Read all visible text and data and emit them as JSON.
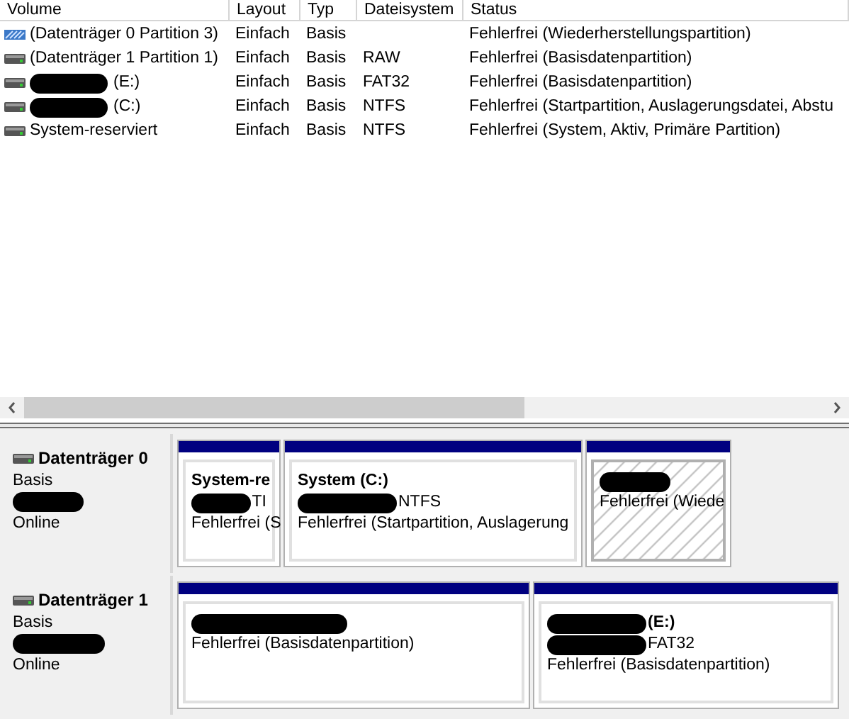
{
  "columns": [
    "Volume",
    "Layout",
    "Typ",
    "Dateisystem",
    "Status"
  ],
  "volumes": [
    {
      "kind": "recovery",
      "redacted": false,
      "volume": "(Datenträger 0 Partition 3)",
      "layout": "Einfach",
      "typ": "Basis",
      "status": "Fehlerfrei (Wiederherstellungspartition)"
    },
    {
      "kind": "basic",
      "redacted": false,
      "volume": "(Datenträger 1 Partition 1)",
      "layout": "Einfach",
      "typ": "Basis",
      "dateisystem": "RAW",
      "status": "Fehlerfrei (Basisdatenpartition)"
    },
    {
      "kind": "basic",
      "redacted": true,
      "volume": "(E:)",
      "layout": "Einfach",
      "typ": "Basis",
      "dateisystem": "FAT32",
      "status": "Fehlerfrei (Basisdatenpartition)"
    },
    {
      "kind": "basic",
      "redacted": true,
      "volume": "(C:)",
      "layout": "Einfach",
      "typ": "Basis",
      "dateisystem": "NTFS",
      "status": "Fehlerfrei (Startpartition, Auslagerungsdatei, Abstu"
    },
    {
      "kind": "basic",
      "redacted": false,
      "volume": "System-reserviert",
      "layout": "Einfach",
      "typ": "Basis",
      "dateisystem": "NTFS",
      "status": "Fehlerfrei (System, Aktiv, Primäre Partition)"
    }
  ],
  "disks": [
    {
      "name": "Datenträger 0",
      "type": "Basis",
      "status": "Online",
      "partitions": [
        {
          "kind": "primary",
          "lines": [
            {
              "text": "System-re",
              "bold": true,
              "redacted": false
            },
            {
              "text": "TI",
              "bold": false,
              "redacted": true
            },
            {
              "text": "Fehlerfrei (S",
              "bold": false,
              "redacted": false
            }
          ]
        },
        {
          "kind": "primary",
          "lines": [
            {
              "text": "System  (C:)",
              "bold": true,
              "redacted": false
            },
            {
              "text": "NTFS",
              "bold": false,
              "redacted": true
            },
            {
              "text": "Fehlerfrei (Startpartition, Auslagerung",
              "bold": false,
              "redacted": false
            }
          ]
        },
        {
          "kind": "hatched",
          "lines": [
            {
              "redacted": true
            },
            {
              "text": "Fehlerfrei (Wiede",
              "bold": false,
              "redacted": false
            }
          ]
        }
      ]
    },
    {
      "name": "Datenträger 1",
      "type": "Basis",
      "status": "Online",
      "partitions": [
        {
          "kind": "primary",
          "lines": [
            {
              "redacted": true
            },
            {
              "text": "Fehlerfrei (Basisdatenpartition)",
              "bold": false,
              "redacted": false
            }
          ]
        },
        {
          "kind": "primary",
          "lines": [
            {
              "text": "(E:)",
              "bold": true,
              "redacted": true
            },
            {
              "text": "FAT32",
              "bold": false,
              "redacted": true
            },
            {
              "text": "Fehlerfrei (Basisdatenpartition)",
              "bold": false,
              "redacted": false
            }
          ]
        }
      ]
    }
  ]
}
